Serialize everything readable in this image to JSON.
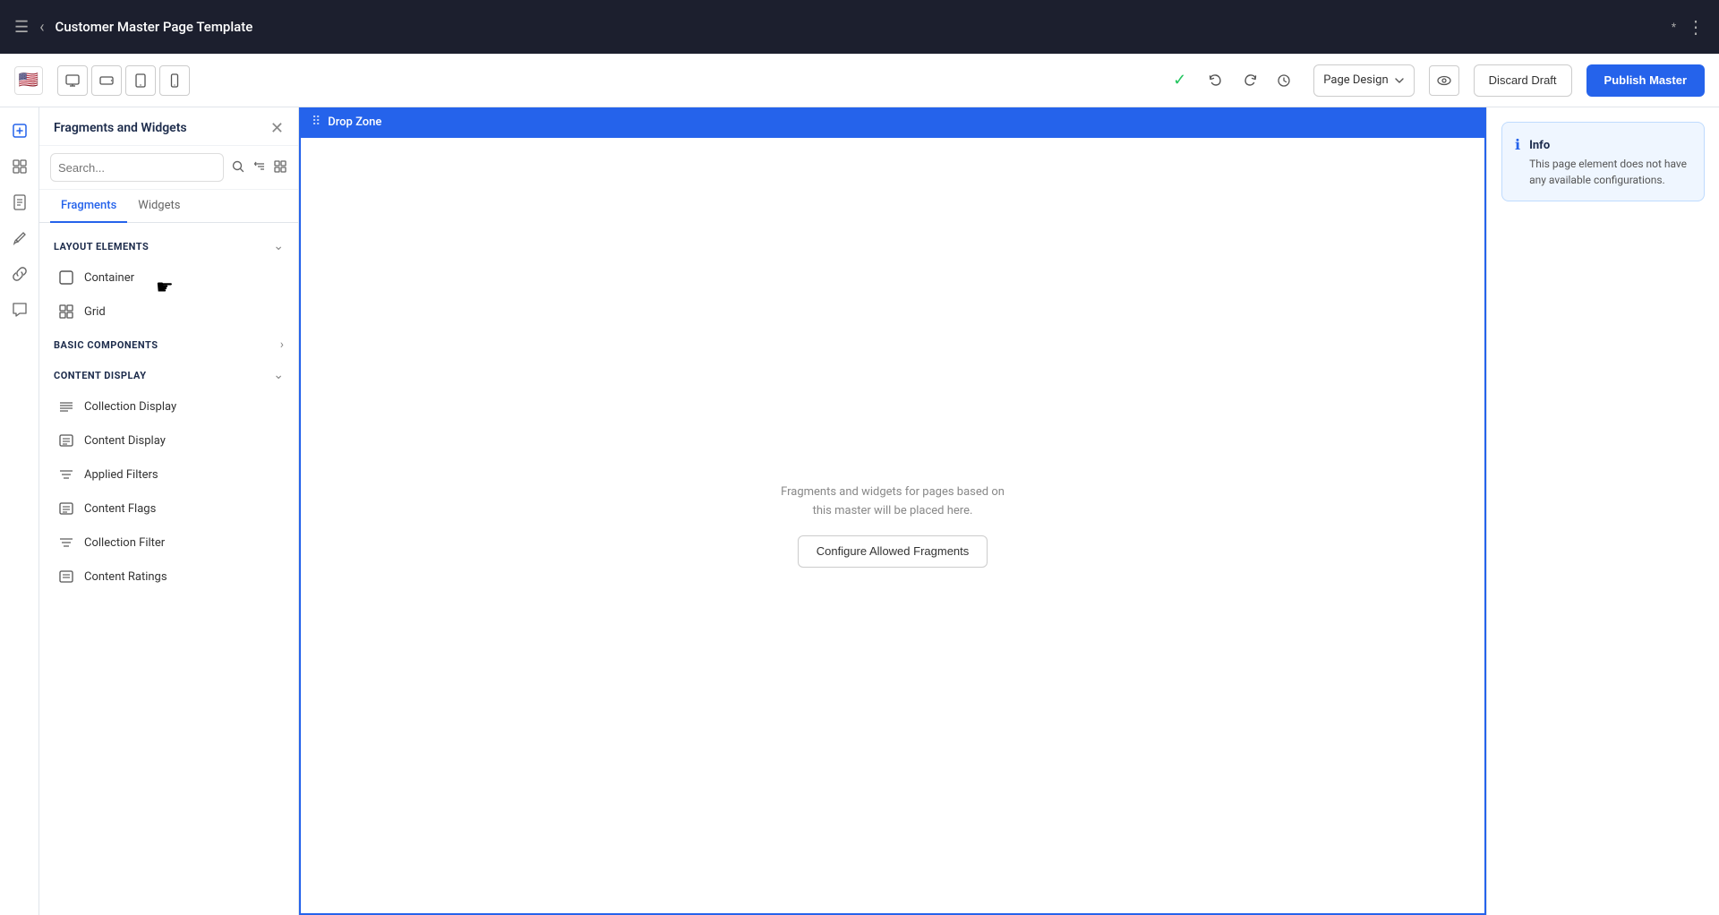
{
  "topbar": {
    "sidebar_icon": "☰",
    "back_icon": "‹",
    "title": "Customer Master Page Template",
    "asterisk": "*",
    "more_icon": "⋮"
  },
  "toolbar": {
    "flag_emoji": "🇺🇸",
    "view_desktop": "🖥",
    "view_tablet_landscape": "⬛",
    "view_tablet": "▭",
    "view_mobile": "📱",
    "check_icon": "✓",
    "undo_icon": "↶",
    "redo_icon": "↷",
    "history_icon": "⏱",
    "page_design_label": "Page Design",
    "page_design_arrow": "⌄",
    "eye_icon": "👁",
    "discard_label": "Discard Draft",
    "publish_label": "Publish Master"
  },
  "fragments_panel": {
    "title": "Fragments and Widgets",
    "close_icon": "✕",
    "search_placeholder": "Search...",
    "search_icon": "🔍",
    "sort_icon": "⇅",
    "grid_icon": "⊞",
    "tab_fragments": "Fragments",
    "tab_widgets": "Widgets",
    "sections": [
      {
        "id": "layout-elements",
        "title": "LAYOUT ELEMENTS",
        "expanded": true,
        "items": [
          {
            "icon": "□",
            "label": "Container"
          },
          {
            "icon": "⊞",
            "label": "Grid"
          }
        ]
      },
      {
        "id": "basic-components",
        "title": "BASIC COMPONENTS",
        "expanded": false,
        "items": []
      },
      {
        "id": "content-display",
        "title": "CONTENT DISPLAY",
        "expanded": true,
        "items": [
          {
            "icon": "≡",
            "label": "Collection Display"
          },
          {
            "icon": "▦",
            "label": "Content Display"
          },
          {
            "icon": "≡",
            "label": "Applied Filters"
          },
          {
            "icon": "▦",
            "label": "Content Flags"
          },
          {
            "icon": "≡",
            "label": "Collection Filter"
          },
          {
            "icon": "▦",
            "label": "Content Ratings"
          }
        ]
      }
    ]
  },
  "canvas": {
    "dropzone_label": "Drop Zone",
    "message_line1": "Fragments and widgets for pages based on",
    "message_line2": "this master will be placed here.",
    "configure_btn": "Configure Allowed Fragments"
  },
  "info_panel": {
    "icon": "ℹ",
    "title": "Info",
    "message": "This page element does not have any available configurations."
  },
  "icon_bar": {
    "items": [
      {
        "id": "plus",
        "icon": "＋",
        "active": false
      },
      {
        "id": "layers",
        "icon": "⧉",
        "active": false
      },
      {
        "id": "page",
        "icon": "📄",
        "active": false
      },
      {
        "id": "brush",
        "icon": "✏",
        "active": false
      },
      {
        "id": "link",
        "icon": "🔗",
        "active": false
      },
      {
        "id": "chat",
        "icon": "💬",
        "active": false
      }
    ]
  }
}
